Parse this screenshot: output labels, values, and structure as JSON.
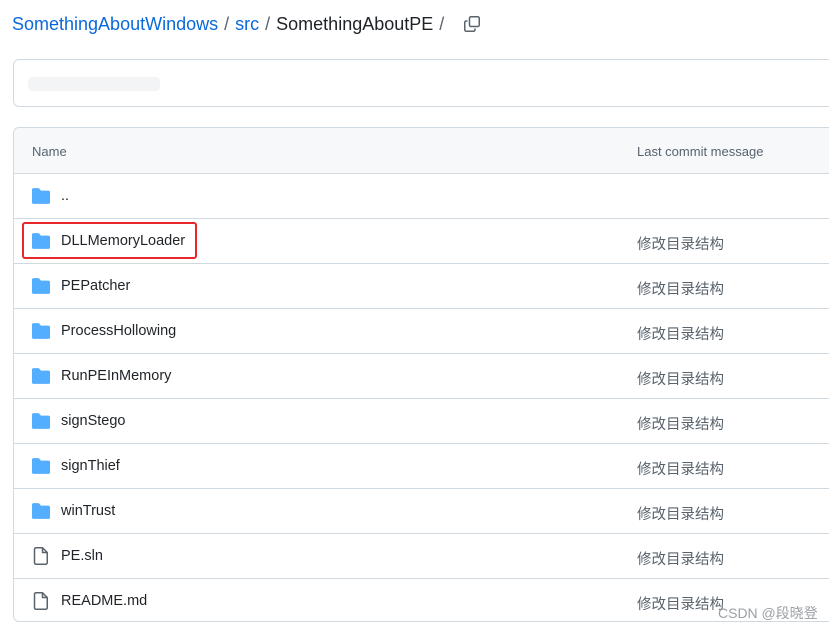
{
  "breadcrumb": {
    "repo": "SomethingAboutWindows",
    "folder": "src",
    "current": "SomethingAboutPE",
    "separator": "/"
  },
  "table": {
    "header_name": "Name",
    "header_commit": "Last commit message",
    "rows": [
      {
        "name": "..",
        "type": "folder",
        "message": ""
      },
      {
        "name": "DLLMemoryLoader",
        "type": "folder",
        "message": "修改目录结构",
        "highlighted": true
      },
      {
        "name": "PEPatcher",
        "type": "folder",
        "message": "修改目录结构"
      },
      {
        "name": "ProcessHollowing",
        "type": "folder",
        "message": "修改目录结构"
      },
      {
        "name": "RunPEInMemory",
        "type": "folder",
        "message": "修改目录结构"
      },
      {
        "name": "signStego",
        "type": "folder",
        "message": "修改目录结构"
      },
      {
        "name": "signThief",
        "type": "folder",
        "message": "修改目录结构"
      },
      {
        "name": "winTrust",
        "type": "folder",
        "message": "修改目录结构"
      },
      {
        "name": "PE.sln",
        "type": "file",
        "message": "修改目录结构"
      },
      {
        "name": "README.md",
        "type": "file",
        "message": "修改目录结构"
      }
    ]
  },
  "icons": {
    "folder": "folder-icon",
    "file": "file-icon",
    "copy": "copy-icon"
  },
  "colors": {
    "link": "#0969da",
    "folder": "#54aeff",
    "highlight": "#e8262e"
  },
  "watermark": "CSDN @段晓登"
}
